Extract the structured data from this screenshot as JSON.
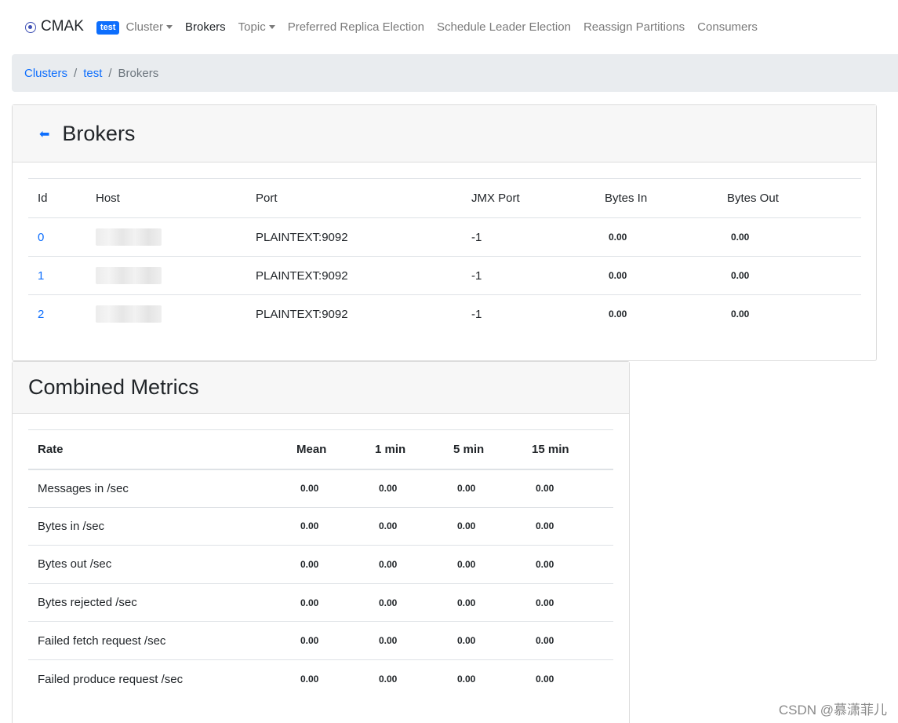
{
  "navbar": {
    "brand": "CMAK",
    "cluster_badge": "test",
    "items": [
      {
        "label": "Cluster",
        "dropdown": true,
        "active": false
      },
      {
        "label": "Brokers",
        "dropdown": false,
        "active": true
      },
      {
        "label": "Topic",
        "dropdown": true,
        "active": false
      },
      {
        "label": "Preferred Replica Election",
        "dropdown": false,
        "active": false
      },
      {
        "label": "Schedule Leader Election",
        "dropdown": false,
        "active": false
      },
      {
        "label": "Reassign Partitions",
        "dropdown": false,
        "active": false
      },
      {
        "label": "Consumers",
        "dropdown": false,
        "active": false
      }
    ]
  },
  "breadcrumb": {
    "items": [
      "Clusters",
      "test"
    ],
    "current": "Brokers",
    "separator": "/"
  },
  "brokers": {
    "title": "Brokers",
    "back_icon": "arrow-left-icon",
    "columns": [
      "Id",
      "Host",
      "Port",
      "JMX Port",
      "Bytes In",
      "Bytes Out"
    ],
    "rows": [
      {
        "id": "0",
        "port": "PLAINTEXT:9092",
        "jmx_port": "-1",
        "bytes_in": "0.00",
        "bytes_out": "0.00"
      },
      {
        "id": "1",
        "port": "PLAINTEXT:9092",
        "jmx_port": "-1",
        "bytes_in": "0.00",
        "bytes_out": "0.00"
      },
      {
        "id": "2",
        "port": "PLAINTEXT:9092",
        "jmx_port": "-1",
        "bytes_in": "0.00",
        "bytes_out": "0.00"
      }
    ]
  },
  "metrics": {
    "title": "Combined Metrics",
    "columns": [
      "Rate",
      "Mean",
      "1 min",
      "5 min",
      "15 min"
    ],
    "rows": [
      {
        "rate": "Messages in /sec",
        "mean": "0.00",
        "m1": "0.00",
        "m5": "0.00",
        "m15": "0.00"
      },
      {
        "rate": "Bytes in /sec",
        "mean": "0.00",
        "m1": "0.00",
        "m5": "0.00",
        "m15": "0.00"
      },
      {
        "rate": "Bytes out /sec",
        "mean": "0.00",
        "m1": "0.00",
        "m5": "0.00",
        "m15": "0.00"
      },
      {
        "rate": "Bytes rejected /sec",
        "mean": "0.00",
        "m1": "0.00",
        "m5": "0.00",
        "m15": "0.00"
      },
      {
        "rate": "Failed fetch request /sec",
        "mean": "0.00",
        "m1": "0.00",
        "m5": "0.00",
        "m15": "0.00"
      },
      {
        "rate": "Failed produce request /sec",
        "mean": "0.00",
        "m1": "0.00",
        "m5": "0.00",
        "m15": "0.00"
      }
    ]
  },
  "watermark": "CSDN @慕潇菲儿",
  "colors": {
    "link": "#0d6efd",
    "badge": "#0d6efd",
    "breadcrumb_bg": "#e9ecef",
    "card_header_bg": "#f7f7f7"
  }
}
